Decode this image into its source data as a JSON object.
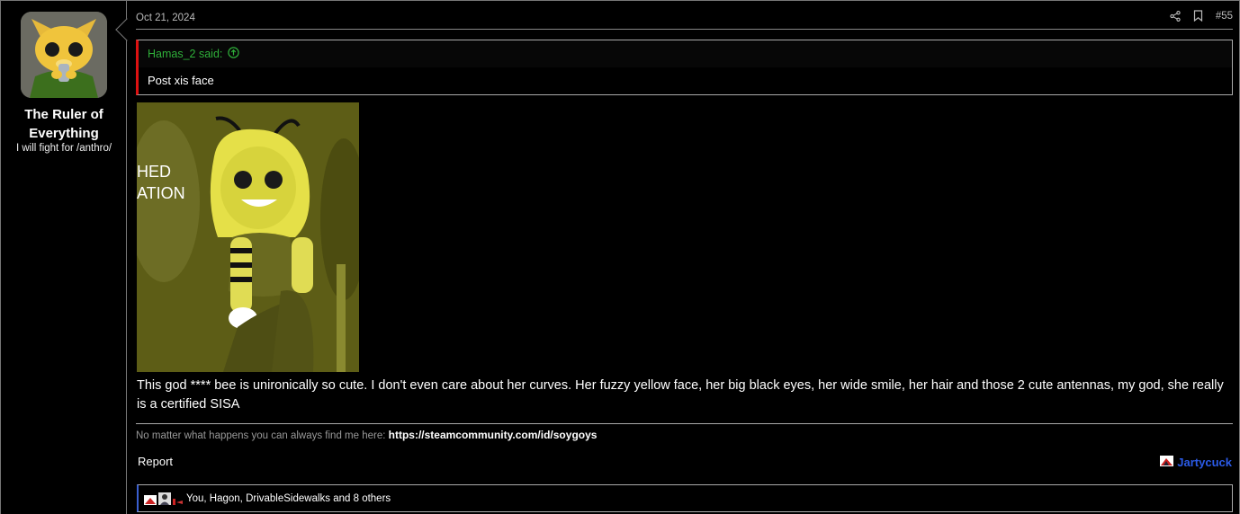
{
  "user": {
    "name": "The Ruler of Everything",
    "title": "I will fight for /anthro/"
  },
  "post": {
    "date": "Oct 21, 2024",
    "number": "#55",
    "quote": {
      "author": "Hamas_2 said:",
      "text": "Post xis face"
    },
    "image_text": [
      "HED",
      "ATION"
    ],
    "message": "This god **** bee is unironically so cute. I don't even care about her curves. Her fuzzy yellow face, her big black eyes, her wide smile, her hair and those 2 cute antennas, my god, she really is a certified SISA",
    "signature": {
      "prefix": "No matter what happens you can always find me here: ",
      "link": "https://steamcommunity.com/id/soygoys"
    },
    "report_label": "Report",
    "last_user": "Jartycuck",
    "reactions_text": "You, Hagon, DrivableSidewalks and 8 others"
  },
  "icons": {
    "share": "share-icon",
    "bookmark": "bookmark-icon",
    "quote_arrow": "arrow-up-circle-icon"
  },
  "colors": {
    "quote_author": "#2fb03a",
    "quote_border": "#dd1111",
    "last_user": "#2b5be8",
    "reaction_border": "#3a5fd0"
  }
}
